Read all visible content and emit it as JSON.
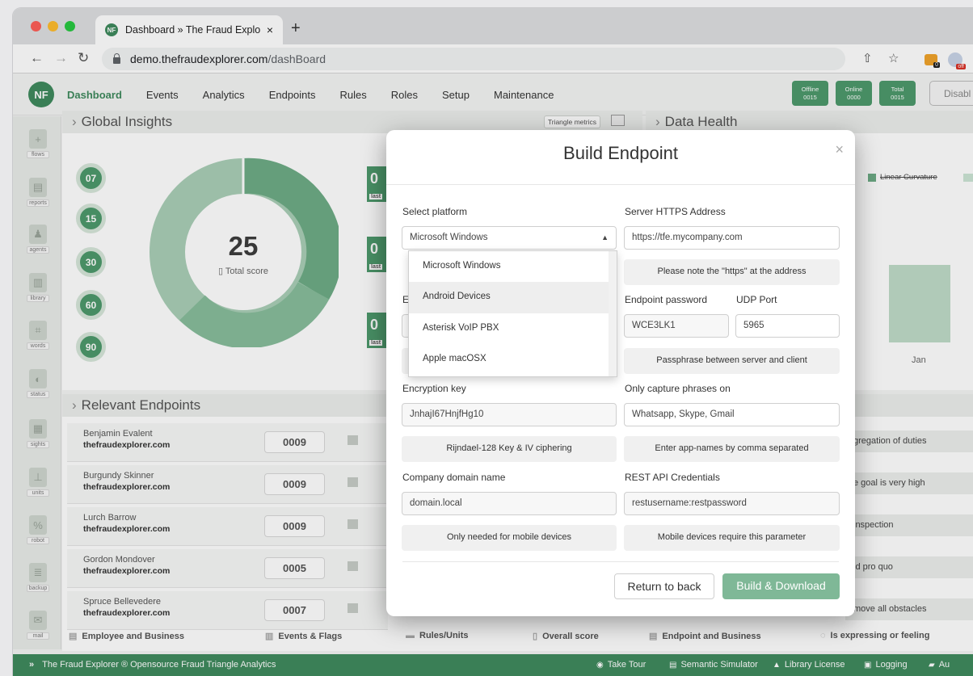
{
  "browser": {
    "tab_title": "Dashboard » The Fraud Explor",
    "tab_close": "×",
    "new_tab": "+",
    "url_host": "demo.thefraudexplorer.com",
    "url_path": "/dashBoard",
    "ext_badge": "0",
    "ext_off": "off",
    "favicon": "NF"
  },
  "app": {
    "logo": "NF",
    "nav": [
      "Dashboard",
      "Events",
      "Analytics",
      "Endpoints",
      "Rules",
      "Roles",
      "Setup",
      "Maintenance"
    ],
    "stats": [
      {
        "label": "Offline",
        "value": "0015"
      },
      {
        "label": "Online",
        "value": "0000"
      },
      {
        "label": "Total",
        "value": "0015"
      }
    ],
    "disable_label": "Disabl",
    "accent": "#3f8a5e"
  },
  "sidebar": [
    "flows",
    "reports",
    "agents",
    "library",
    "words",
    "status",
    "sights",
    "units",
    "robot",
    "backup",
    "mail"
  ],
  "insights": {
    "title": "Global Insights",
    "triangle_tag": "Triangle metrics",
    "levels": [
      "07",
      "15",
      "30",
      "60",
      "90"
    ],
    "score": "25",
    "score_label": "Total score",
    "mini": [
      {
        "v": "0",
        "sub": "last"
      },
      {
        "v": "0",
        "sub": "last"
      },
      {
        "v": "0",
        "sub": "last"
      }
    ]
  },
  "health": {
    "title": "Data Health",
    "legend": "Linear Curvature",
    "month": "Jan"
  },
  "endpoints": {
    "title": "Relevant Endpoints",
    "rows": [
      {
        "name": "Benjamin Evalent",
        "domain": "thefraudexplorer.com",
        "score": "0009"
      },
      {
        "name": "Burgundy Skinner",
        "domain": "thefraudexplorer.com",
        "score": "0009"
      },
      {
        "name": "Lurch Barrow",
        "domain": "thefraudexplorer.com",
        "score": "0009"
      },
      {
        "name": "Gordon Mondover",
        "domain": "thefraudexplorer.com",
        "score": "0005"
      },
      {
        "name": "Spruce Bellevedere",
        "domain": "thefraudexplorer.com",
        "score": "0007"
      }
    ],
    "columns": [
      "Employee and Business",
      "Events & Flags",
      "Rules/Units",
      "Overall score",
      "Endpoint and Business",
      "Is expressing or feeling"
    ],
    "right_items": [
      "gregation of duties",
      "e goal is very high",
      "inspection",
      "id pro quo",
      "move all obstacles"
    ]
  },
  "modal": {
    "title": "Build Endpoint",
    "close": "×",
    "select_platform_label": "Select platform",
    "platform_value": "Microsoft Windows",
    "platform_options": [
      "Microsoft Windows",
      "Android Devices",
      "Asterisk VoIP PBX",
      "Apple macOSX"
    ],
    "server_label": "Server HTTPS Address",
    "server_value": "https://tfe.mycompany.com",
    "server_note": "Please note the \"https\" at the address",
    "password_label": "Endpoint password",
    "password_value": "WCE3LK1",
    "udp_label": "UDP Port",
    "udp_value": "5965",
    "passphrase_note": "Passphrase between server and client",
    "hidden_label_initial": "E",
    "encryption_label": "Encryption key",
    "encryption_value": "JnhajI67HnjfHg10",
    "encryption_note": "Rijndael-128 Key & IV ciphering",
    "capture_label": "Only capture phrases on",
    "capture_value": "Whatsapp, Skype, Gmail",
    "capture_note": "Enter app-names by comma separated",
    "domain_label": "Company domain name",
    "domain_value": "domain.local",
    "domain_note": "Only needed for mobile devices",
    "rest_label": "REST API Credentials",
    "rest_value": "restusername:restpassword",
    "rest_note": "Mobile devices require this parameter",
    "back_button": "Return to back",
    "build_button": "Build & Download"
  },
  "footer": {
    "left": "The Fraud Explorer ® Opensource Fraud Triangle Analytics",
    "links": [
      "Take Tour",
      "Semantic Simulator",
      "Library License",
      "Logging",
      "Au"
    ]
  }
}
